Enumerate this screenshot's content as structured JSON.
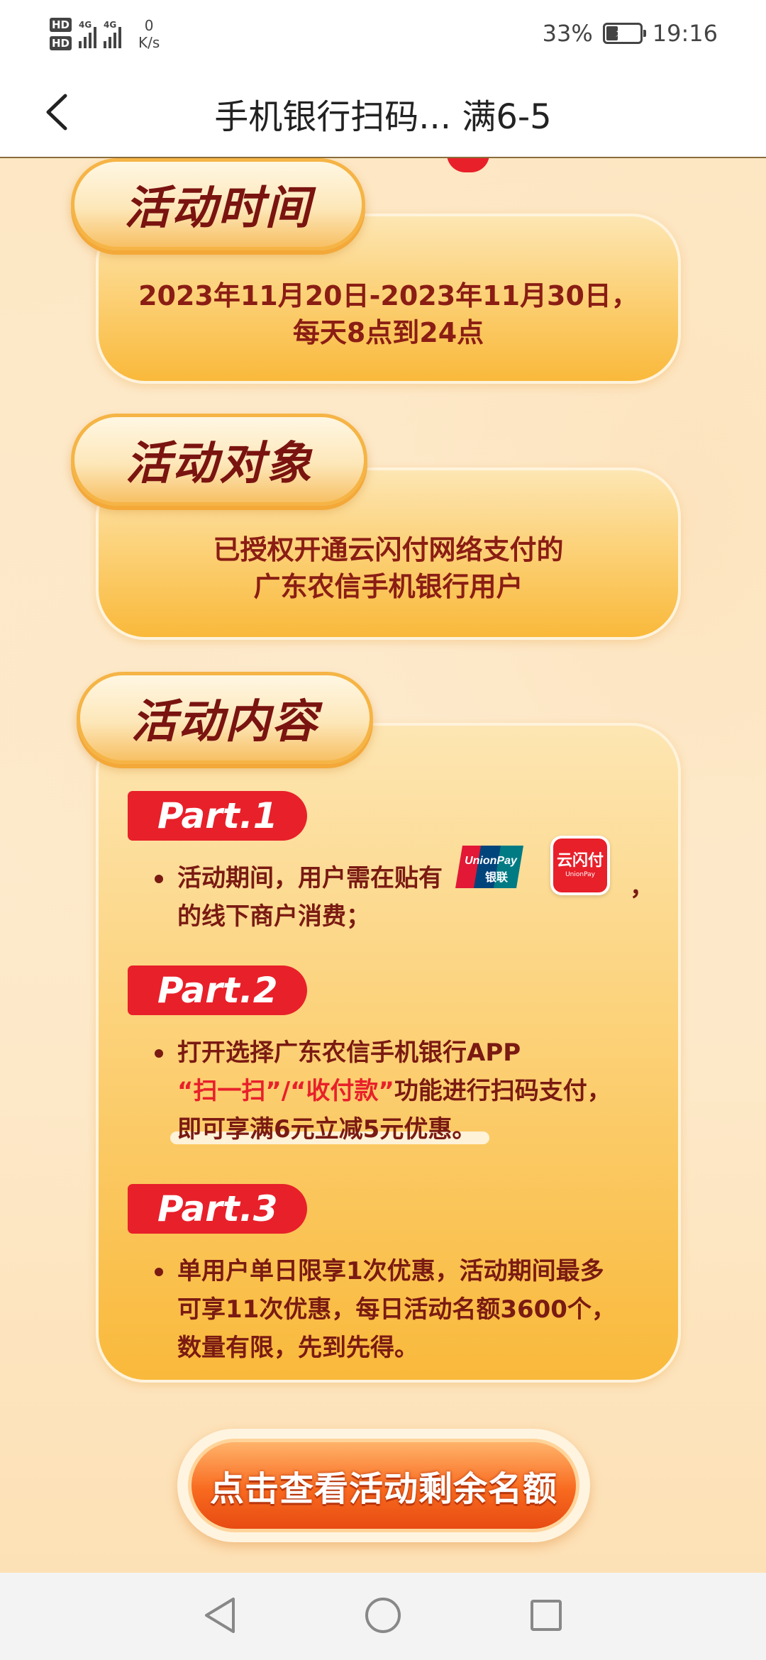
{
  "status_bar": {
    "hd1": "HD",
    "hd2": "HD",
    "net1": "4G",
    "net2": "4G",
    "speed_value": "0",
    "speed_unit": "K/s",
    "battery": "33%",
    "time": "19:16"
  },
  "header": {
    "title": "手机银行扫码... 满6-5"
  },
  "sections": {
    "time": {
      "label": "活动时间",
      "line1": "2023年11月20日-2023年11月30日，",
      "line2": "每天8点到24点"
    },
    "target": {
      "label": "活动对象",
      "line1": "已授权开通云闪付网络支付的",
      "line2": "广东农信手机银行用户"
    },
    "content": {
      "label": "活动内容",
      "part1": {
        "tag": "Part.1",
        "line1": "活动期间，用户需在贴有",
        "comma": "，",
        "line2": "的线下商户消费；"
      },
      "part2": {
        "tag": "Part.2",
        "line1": "打开选择广东农信手机银行APP",
        "line2_red": "“扫一扫”/“收付款”",
        "line2_rest": "功能进行扫码支付，",
        "line3": "即可享满6元立减5元优惠。"
      },
      "part3": {
        "tag": "Part.3",
        "line1": "单用户单日限享1次优惠，活动期间最多",
        "line2": "可享11次优惠，每日活动名额3600个，",
        "line3": "数量有限，先到先得。"
      }
    }
  },
  "logos": {
    "unionpay_en": "UnionPay",
    "unionpay_cn": "银联",
    "ysf_cn": "云闪付",
    "ysf_en": "UnionPay"
  },
  "cta": {
    "label": "点击查看活动剩余名额"
  },
  "colors": {
    "accent_red": "#e8202a",
    "text_dark_red": "#7a1a12",
    "card_orange": "#f9b93b"
  },
  "icons": {
    "back": "chevron-left-icon",
    "nav_back": "triangle-back-icon",
    "nav_home": "circle-home-icon",
    "nav_recent": "square-recent-icon"
  }
}
